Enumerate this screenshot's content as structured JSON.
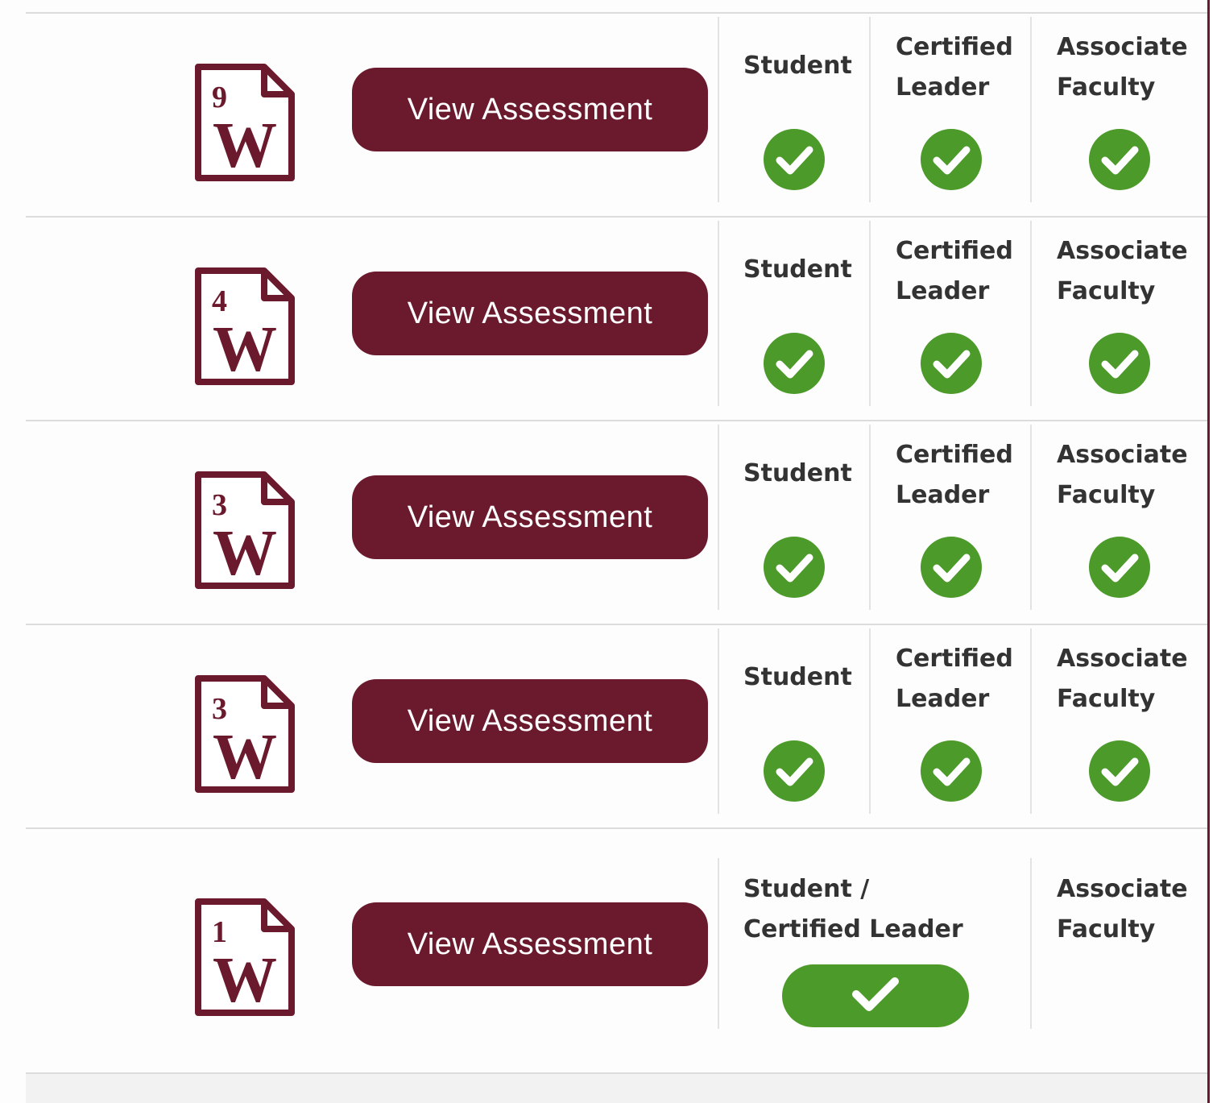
{
  "colors": {
    "brand": "#6b1a2e",
    "success": "#4c9a2a",
    "divider": "#dcdcdc",
    "label_text": "#333333"
  },
  "icons": {
    "document": "word-document-icon",
    "status": "check-circle-icon"
  },
  "rows": [
    {
      "doc_number": "9",
      "doc_letter": "W",
      "button_label": "View Assessment",
      "columns": [
        {
          "label_lines": [
            "Student"
          ],
          "status": "complete"
        },
        {
          "label_lines": [
            "Certified",
            "Leader"
          ],
          "status": "complete"
        },
        {
          "label_lines": [
            "Associate",
            "Faculty"
          ],
          "status": "complete"
        }
      ]
    },
    {
      "doc_number": "4",
      "doc_letter": "W",
      "button_label": "View Assessment",
      "columns": [
        {
          "label_lines": [
            "Student"
          ],
          "status": "complete"
        },
        {
          "label_lines": [
            "Certified",
            "Leader"
          ],
          "status": "complete"
        },
        {
          "label_lines": [
            "Associate",
            "Faculty"
          ],
          "status": "complete"
        }
      ]
    },
    {
      "doc_number": "3",
      "doc_letter": "W",
      "button_label": "View Assessment",
      "columns": [
        {
          "label_lines": [
            "Student"
          ],
          "status": "complete"
        },
        {
          "label_lines": [
            "Certified",
            "Leader"
          ],
          "status": "complete"
        },
        {
          "label_lines": [
            "Associate",
            "Faculty"
          ],
          "status": "complete"
        }
      ]
    },
    {
      "doc_number": "3",
      "doc_letter": "W",
      "button_label": "View Assessment",
      "columns": [
        {
          "label_lines": [
            "Student"
          ],
          "status": "complete"
        },
        {
          "label_lines": [
            "Certified",
            "Leader"
          ],
          "status": "complete"
        },
        {
          "label_lines": [
            "Associate",
            "Faculty"
          ],
          "status": "complete"
        }
      ]
    }
  ],
  "last_row": {
    "doc_number": "1",
    "doc_letter": "W",
    "button_label": "View Assessment",
    "combined_label_lines": [
      "Student /",
      "Certified Leader"
    ],
    "combined_status": "complete",
    "faculty_label_lines": [
      "Associate",
      "Faculty"
    ],
    "faculty_status": "none"
  }
}
